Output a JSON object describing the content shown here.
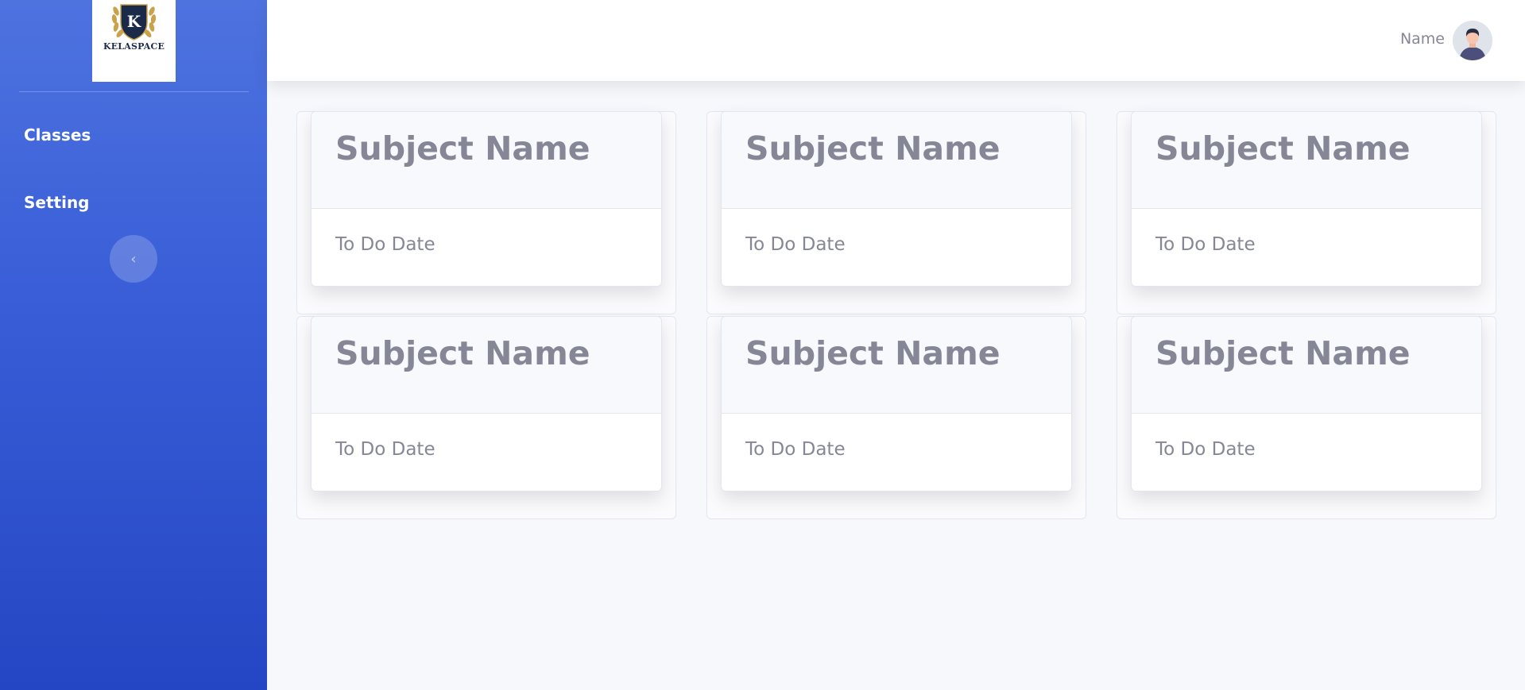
{
  "brand": {
    "logo_letter": "K",
    "logo_text": "KELASPACE"
  },
  "sidebar": {
    "items": [
      {
        "label": "Classes"
      },
      {
        "label": "Setting"
      }
    ],
    "toggle_icon": "chevron-left-icon"
  },
  "topbar": {
    "user_name": "Name",
    "avatar_icon": "user-avatar-icon"
  },
  "cards": [
    {
      "title": "Subject Name",
      "subtitle": "To Do Date"
    },
    {
      "title": "Subject Name",
      "subtitle": "To Do Date"
    },
    {
      "title": "Subject Name",
      "subtitle": "To Do Date"
    },
    {
      "title": "Subject Name",
      "subtitle": "To Do Date"
    },
    {
      "title": "Subject Name",
      "subtitle": "To Do Date"
    },
    {
      "title": "Subject Name",
      "subtitle": "To Do Date"
    }
  ],
  "colors": {
    "sidebar_top": "#4e73df",
    "sidebar_bottom": "#2546c4",
    "page_bg": "#f7f8fc",
    "text_muted": "#858796",
    "logo_navy": "#1c2a4a",
    "logo_gold": "#c9a24a"
  }
}
